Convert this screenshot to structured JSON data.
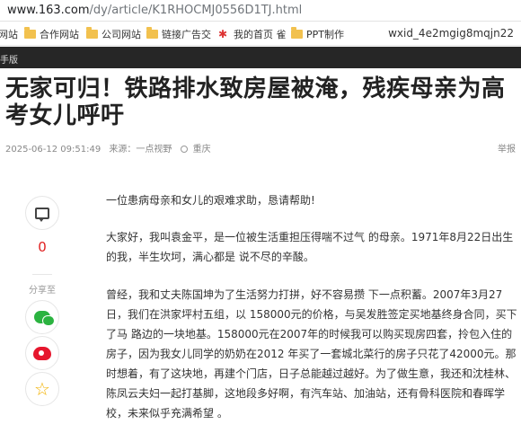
{
  "browser": {
    "url_host": "www.163.com",
    "url_path": "/dy/article/K1RHOCMJ0556D1TJ.html",
    "bookmarks": [
      {
        "label": "网站",
        "icon": "none"
      },
      {
        "label": "合作网站",
        "icon": "folder-icon"
      },
      {
        "label": "公司网站",
        "icon": "folder-icon"
      },
      {
        "label": "链接广告交",
        "icon": "folder-icon"
      },
      {
        "label": "我的首页 雀",
        "icon": "home-icon"
      },
      {
        "label": "PPT制作",
        "icon": "folder-icon"
      }
    ],
    "account": "wxid_4e2mgig8mqjn22"
  },
  "site": {
    "strip_text": "手版"
  },
  "article": {
    "title": "无家可归！铁路排水致房屋被淹，残疾母亲为高考女儿呼吁",
    "datetime": "2025-06-12 09:51:49",
    "source": "来源：一点视野",
    "location": "重庆",
    "report_label": "举报",
    "paragraphs": [
      "一位患病母亲和女儿的艰难求助，恳请帮助!",
      "大家好，我叫袁金平，是一位被生活重担压得喘不过气 的母亲。1971年8月22日出生的我，半生坎坷，满心都是 说不尽的辛酸。",
      "曾经，我和丈夫陈国坤为了生活努力打拼，好不容易攒 下一点积蓄。2007年3月27日，我们在洪家坪村五组，以 158000元的价格，与吴发胜签定买地基终身合同，买下了马 路边的一块地基。158000元在2007年的时候我可以购买现房四套，拎包入住的房子，因为我女儿同学的奶奶在2012 年买了一套城北菜行的房子只花了42000元。那时想着，有了这块地，再建个门店，日子总能越过越好。为了做生意，我还和沈桂林、陈凤云夫妇一起打基脚，这地段多好啊，有汽车站、加油站，还有骨科医院和春晖学校，未来似乎充满希望 。"
    ]
  },
  "sidebar": {
    "comment_count": "0",
    "share_label": "分享至"
  }
}
